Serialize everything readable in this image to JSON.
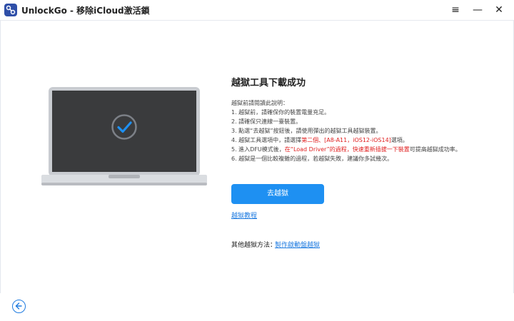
{
  "app": {
    "title": "UnlockGo - 移除iCloud激活鎖"
  },
  "window": {
    "menu_icon": "≡",
    "minimize_icon": "—",
    "close_icon": "✕"
  },
  "main": {
    "heading": "越獄工具下載成功",
    "intro": "越獄前請閱讀此說明：",
    "steps": {
      "s1": "1. 越獄前，請確保你的裝置電量充足。",
      "s2": "2. 請確保只連線一臺裝置。",
      "s3": "3. 點選“去越獄”按鈕後，請使用彈出的越獄工具越獄裝置。",
      "s4_a": "4. 越獄工具選項中，請選擇",
      "s4_b": "第二個、[A8-A11，iOS12-iOS14]",
      "s4_c": "選項。",
      "s5_a": "5. 進入DFU模式後，",
      "s5_b": "在“Load Driver”的過程，快速重新插拔一下裝置",
      "s5_c": "可提高越獄成功率。",
      "s6": "6. 越獄是一個比較複雜的過程，若越獄失敗，建議你多試幾次。"
    },
    "primary_button": "去越獄",
    "tutorial_link": "越獄教程",
    "other_label": "其他越獄方法：",
    "other_link": "製作啟動盤越獄"
  },
  "colors": {
    "accent": "#1e90f2",
    "link": "#1e7be0",
    "warning": "#e02020"
  },
  "icons": {
    "logo": "unlockgo-logo",
    "check": "check-circle-icon",
    "back": "back-arrow-icon"
  }
}
